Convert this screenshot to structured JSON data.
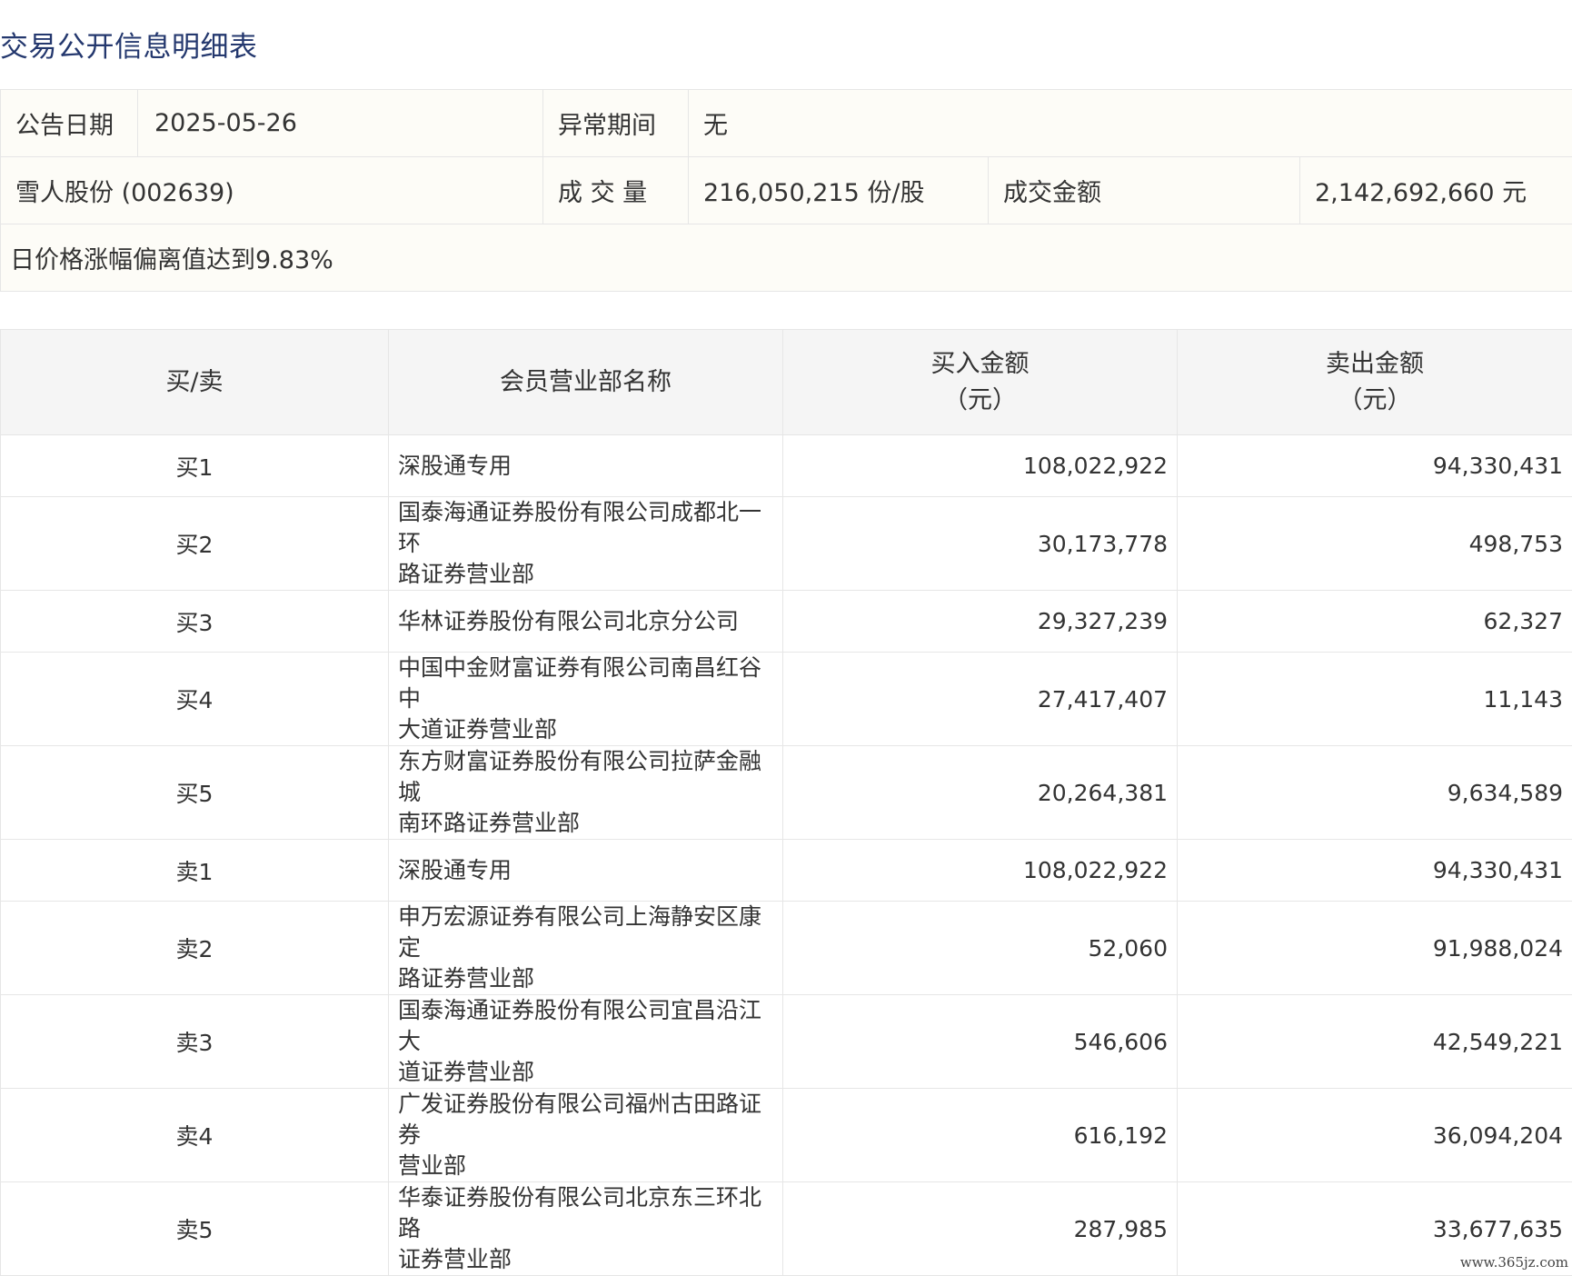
{
  "title": "交易公开信息明细表",
  "info": {
    "announce_date_label": "公告日期",
    "announce_date": "2025-05-26",
    "abnormal_period_label": "异常期间",
    "abnormal_period": "无",
    "stock": "雪人股份 (002639)",
    "volume_label": "成 交 量",
    "volume": "216,050,215 份/股",
    "amount_label": "成交金额",
    "amount": "2,142,692,660 元",
    "reason": "日价格涨幅偏离值达到9.83%"
  },
  "table": {
    "headers": {
      "side": "买/卖",
      "member": "会员营业部名称",
      "buy_line1": "买入金额",
      "buy_line2": "（元）",
      "sell_line1": "卖出金额",
      "sell_line2": "（元）"
    },
    "rows": [
      {
        "side": "买1",
        "name_1": "深股通专用",
        "name_2": "",
        "buy": "108,022,922",
        "sell": "94,330,431"
      },
      {
        "side": "买2",
        "name_1": "国泰海通证券股份有限公司成都北一环",
        "name_2": "路证券营业部",
        "buy": "30,173,778",
        "sell": "498,753"
      },
      {
        "side": "买3",
        "name_1": "华林证券股份有限公司北京分公司",
        "name_2": "",
        "buy": "29,327,239",
        "sell": "62,327"
      },
      {
        "side": "买4",
        "name_1": "中国中金财富证券有限公司南昌红谷中",
        "name_2": "大道证券营业部",
        "buy": "27,417,407",
        "sell": "11,143"
      },
      {
        "side": "买5",
        "name_1": "东方财富证券股份有限公司拉萨金融城",
        "name_2": "南环路证券营业部",
        "buy": "20,264,381",
        "sell": "9,634,589"
      },
      {
        "side": "卖1",
        "name_1": "深股通专用",
        "name_2": "",
        "buy": "108,022,922",
        "sell": "94,330,431"
      },
      {
        "side": "卖2",
        "name_1": "申万宏源证券有限公司上海静安区康定",
        "name_2": "路证券营业部",
        "buy": "52,060",
        "sell": "91,988,024"
      },
      {
        "side": "卖3",
        "name_1": "国泰海通证券股份有限公司宜昌沿江大",
        "name_2": "道证券营业部",
        "buy": "546,606",
        "sell": "42,549,221"
      },
      {
        "side": "卖4",
        "name_1": "广发证券股份有限公司福州古田路证券",
        "name_2": "营业部",
        "buy": "616,192",
        "sell": "36,094,204"
      },
      {
        "side": "卖5",
        "name_1": "华泰证券股份有限公司北京东三环北路",
        "name_2": "证券营业部",
        "buy": "287,985",
        "sell": "33,677,635"
      }
    ]
  },
  "watermark": "www.365jz.com"
}
